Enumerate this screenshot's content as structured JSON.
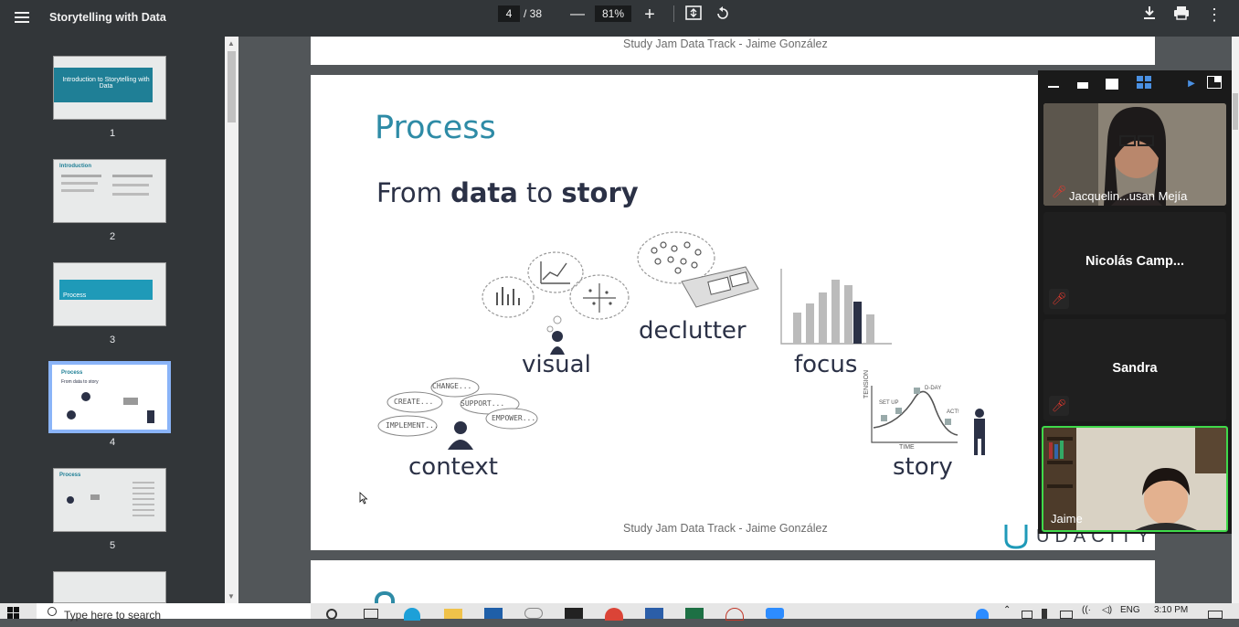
{
  "toolbar": {
    "title": "Storytelling with Data",
    "page_current": "4",
    "page_total": "/ 38",
    "zoom": "81%",
    "icons": [
      "menu-icon",
      "zoom-out-icon",
      "zoom-in-icon",
      "fit-page-icon",
      "rotate-icon",
      "download-icon",
      "print-icon",
      "more-icon"
    ]
  },
  "sidebar": {
    "thumbnails": [
      {
        "number": "1",
        "title": "Introduction to Storytelling with Data"
      },
      {
        "number": "2",
        "title": "Introduction"
      },
      {
        "number": "3",
        "title": "Process"
      },
      {
        "number": "4",
        "title": "Process",
        "subtitle": "From data to story"
      },
      {
        "number": "5",
        "title": "Process"
      }
    ],
    "selected_page": 4
  },
  "pages": {
    "footer": "Study Jam Data Track - Jaime González",
    "slide": {
      "title": "Process",
      "subtitle_prefix": "From ",
      "subtitle_bold1": "data",
      "subtitle_mid": " to ",
      "subtitle_bold2": "story",
      "labels": {
        "visual": "visual",
        "declutter": "declutter",
        "focus": "focus",
        "context": "context",
        "story": "story"
      },
      "bubbles": [
        "CHANGE...",
        "CREATE...",
        "SUPPORT...",
        "IMPLEMENT...",
        "EMPOWER..."
      ],
      "story_chart_words": [
        "TENSION",
        "TIME",
        "SET UP",
        "D-DAY",
        "ACT!"
      ],
      "logo": "UDACITY"
    }
  },
  "video_panel": {
    "participants": [
      {
        "name": "Jacquelin...usan Mejía",
        "muted": true,
        "video": true
      },
      {
        "name": "Nicolás Camp...",
        "muted": true,
        "video": false
      },
      {
        "name": "Sandra",
        "muted": true,
        "video": false
      },
      {
        "name": "Jaime",
        "muted": false,
        "video": true,
        "active_speaker": true
      }
    ]
  },
  "taskbar": {
    "search_placeholder": "Type here to search",
    "language": "ENG",
    "time": "3:10 PM"
  },
  "colors": {
    "accent": "#2e8ba6",
    "dark_text": "#2b3146",
    "active_speaker": "#3fd94a",
    "selected_thumb": "#8ab4f8"
  }
}
